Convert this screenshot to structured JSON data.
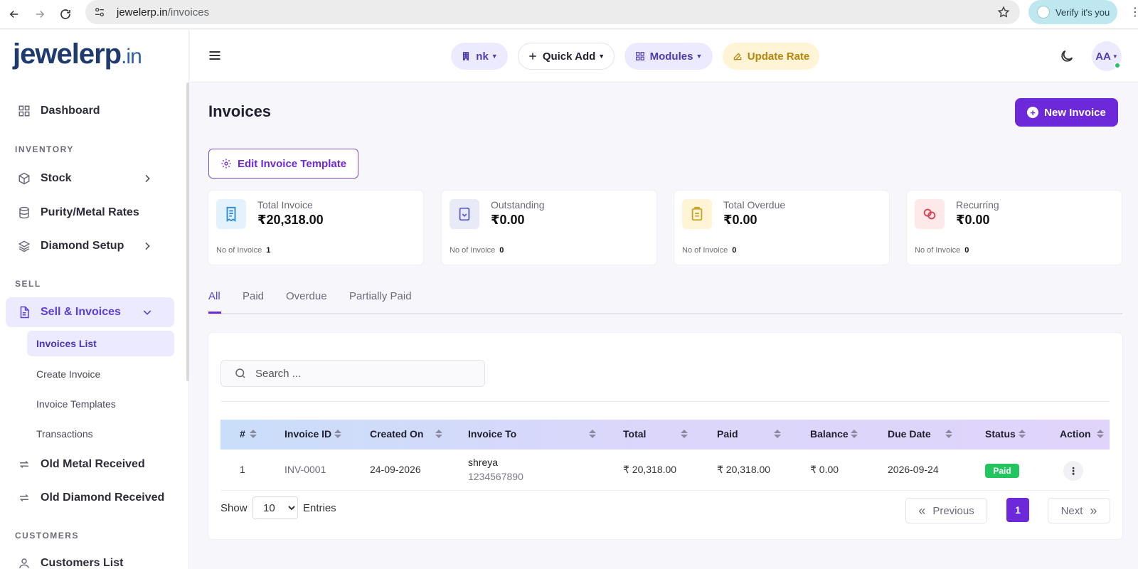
{
  "browser": {
    "url_host": "jewelerp.in",
    "url_path": "/invoices",
    "verify_label": "Verify it's you"
  },
  "logo": {
    "main": "jewelerp",
    "tld": ".in"
  },
  "sidebar": {
    "dashboard": "Dashboard",
    "section_inventory": "INVENTORY",
    "stock": "Stock",
    "purity": "Purity/Metal Rates",
    "diamond": "Diamond Setup",
    "section_sell": "SELL",
    "sell_invoices": "Sell & Invoices",
    "sub_items": [
      "Invoices List",
      "Create Invoice",
      "Invoice Templates",
      "Transactions"
    ],
    "old_metal": "Old Metal Received",
    "old_diamond": "Old Diamond Received",
    "section_customers": "CUSTOMERS",
    "customers_list": "Customers List"
  },
  "topbar": {
    "nk": "nk",
    "quick_add": "Quick Add",
    "modules": "Modules",
    "update_rate": "Update Rate",
    "avatar": "AA"
  },
  "page": {
    "title": "Invoices",
    "new_invoice": "New Invoice",
    "edit_template": "Edit Invoice Template"
  },
  "stats": [
    {
      "label": "Total Invoice",
      "value": "₹20,318.00",
      "foot_label": "No of Invoice",
      "foot_value": "1",
      "bg": "#e3f2fd",
      "color": "#2a8bd8"
    },
    {
      "label": "Outstanding",
      "value": "₹0.00",
      "foot_label": "No of Invoice",
      "foot_value": "0",
      "bg": "#e8eaf8",
      "color": "#5b5fc7"
    },
    {
      "label": "Total Overdue",
      "value": "₹0.00",
      "foot_label": "No of Invoice",
      "foot_value": "0",
      "bg": "#fff5d6",
      "color": "#c9a227"
    },
    {
      "label": "Recurring",
      "value": "₹0.00",
      "foot_label": "No of Invoice",
      "foot_value": "0",
      "bg": "#fde8ea",
      "color": "#d9404f"
    }
  ],
  "tabs": [
    "All",
    "Paid",
    "Overdue",
    "Partially Paid"
  ],
  "search": {
    "placeholder": "Search ..."
  },
  "table": {
    "headers": [
      "#",
      "Invoice ID",
      "Created On",
      "Invoice To",
      "Total",
      "Paid",
      "Balance",
      "Due Date",
      "Status",
      "Action"
    ],
    "row": {
      "num": "1",
      "invoice_id": "INV-0001",
      "created_on": "24-09-2026",
      "name": "shreya",
      "phone": "1234567890",
      "total": "₹ 20,318.00",
      "paid": "₹ 20,318.00",
      "balance": "₹ 0.00",
      "due_date": "2026-09-24",
      "status": "Paid"
    }
  },
  "pagination": {
    "show": "Show",
    "entries_value": "10",
    "entries": "Entries",
    "previous": "Previous",
    "page": "1",
    "next": "Next"
  }
}
